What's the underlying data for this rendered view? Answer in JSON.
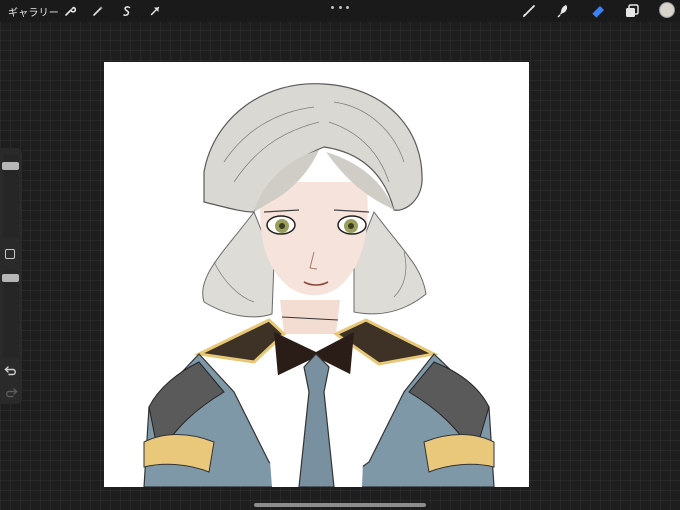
{
  "topbar": {
    "gallery_label": "ギャラリー",
    "left_tools": [
      "wrench-icon",
      "magic-wand-icon",
      "selection-icon",
      "transform-arrow-icon"
    ],
    "more_icon": "more-dots-icon",
    "right_tools": [
      "brush-icon",
      "smudge-icon",
      "eraser-icon",
      "layers-icon"
    ],
    "active_tool": "eraser-icon",
    "current_color": "#d8d4cc",
    "accent_color": "#3b82f6"
  },
  "sidebar": {
    "size_slider_level": 0.08,
    "opacity_slider_level": 0.05,
    "modify_button_icon": "square-icon",
    "undo_icon": "undo-icon",
    "redo_icon": "redo-icon"
  },
  "canvas": {
    "background_color": "#ffffff",
    "artwork": "sketch-portrait"
  }
}
